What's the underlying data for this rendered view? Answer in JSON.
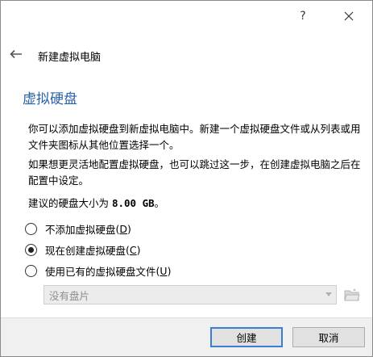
{
  "titlebar": {
    "help_label": "?"
  },
  "wizard": {
    "title": "新建虚拟电脑",
    "page_title": "虚拟硬盘",
    "paragraph_1": "你可以添加虚拟硬盘到新虚拟电脑中。新建一个虚拟硬盘文件或从列表或用文件夹图标从其他位置选择一个。",
    "paragraph_2": "如果想更灵活地配置虚拟硬盘，也可以跳过这一步，在创建虚拟电脑之后在配置中设定。",
    "recommend_prefix": "建议的硬盘大小为 ",
    "recommend_size": "8.00 GB",
    "recommend_suffix": "。"
  },
  "options": [
    {
      "label": "不添加虚拟硬盘",
      "accel": "D",
      "checked": false
    },
    {
      "label": "现在创建虚拟硬盘",
      "accel": "C",
      "checked": true
    },
    {
      "label": "使用已有的虚拟硬盘文件",
      "accel": "U",
      "checked": false
    }
  ],
  "disk_combo": {
    "value": "没有盘片",
    "enabled": false
  },
  "buttons": {
    "create": "创建",
    "cancel": "取消"
  },
  "icons": {
    "help": "help-icon",
    "close": "close-icon",
    "back": "back-arrow-icon",
    "folder": "choose-disk-folder-icon"
  },
  "colors": {
    "title_blue": "#2a62a8",
    "primary_border": "#3c7fd1"
  }
}
